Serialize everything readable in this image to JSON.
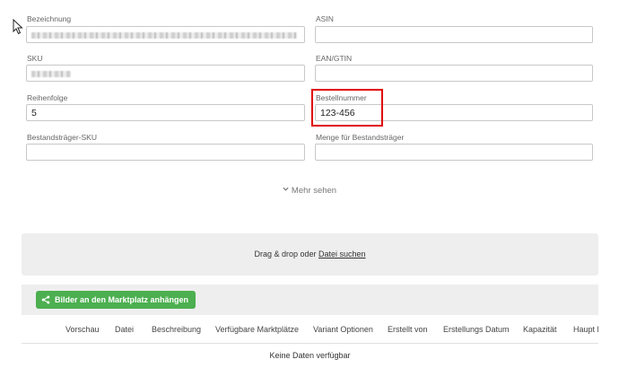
{
  "fields": {
    "bezeichnung": {
      "label": "Bezeichnung"
    },
    "asin": {
      "label": "ASIN",
      "value": ""
    },
    "sku": {
      "label": "SKU"
    },
    "ean": {
      "label": "EAN/GTIN",
      "value": ""
    },
    "reihenfolge": {
      "label": "Reihenfolge",
      "value": "5"
    },
    "bestellnummer": {
      "label": "Bestellnummer",
      "value": "123-456"
    },
    "bestandstraeger_sku": {
      "label": "Bestandsträger-SKU",
      "value": ""
    },
    "menge": {
      "label": "Menge für Bestandsträger",
      "value": ""
    }
  },
  "more_label": "Mehr sehen",
  "dropzone": {
    "text": "Drag & drop oder ",
    "link": "Datei suchen"
  },
  "attach_button": {
    "label": "Bilder an den Marktplatz anhängen",
    "icon": "share-icon",
    "color": "#4caf50"
  },
  "table": {
    "columns": [
      "Vorschau",
      "Datei",
      "Beschreibung",
      "Verfügbare Marktplätze",
      "Variant Optionen",
      "Erstellt von",
      "Erstellungs Datum",
      "Kapazität",
      "Haupt B"
    ],
    "empty_text": "Keine Daten verfügbar"
  },
  "highlight_color": "#e00000"
}
